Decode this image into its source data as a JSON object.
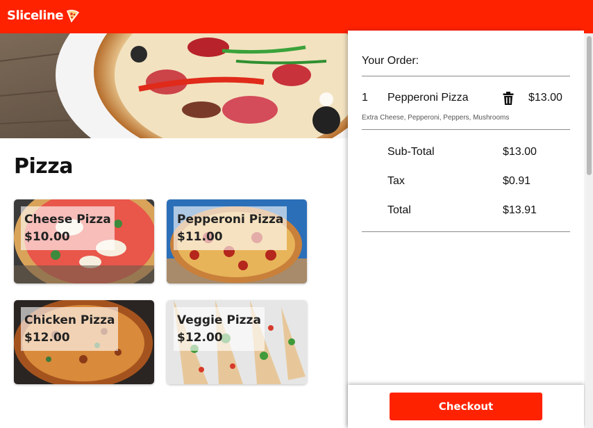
{
  "app": {
    "brand": "Sliceline",
    "brand_color": "#ff2200"
  },
  "menu": {
    "section_title": "Pizza",
    "items": [
      {
        "name": "Cheese Pizza",
        "price": "$10.00"
      },
      {
        "name": "Pepperoni Pizza",
        "price": "$11.00"
      },
      {
        "name": "Chicken Pizza",
        "price": "$12.00"
      },
      {
        "name": "Veggie Pizza",
        "price": "$12.00"
      }
    ]
  },
  "order": {
    "heading": "Your Order:",
    "items": [
      {
        "qty": "1",
        "name": "Pepperoni Pizza",
        "price": "$13.00",
        "modifiers": "Extra Cheese, Pepperoni, Peppers, Mushrooms",
        "remove_icon": "trash-icon"
      }
    ],
    "subtotal_label": "Sub-Total",
    "subtotal": "$13.00",
    "tax_label": "Tax",
    "tax": "$0.91",
    "total_label": "Total",
    "total": "$13.91",
    "checkout_label": "Checkout"
  }
}
